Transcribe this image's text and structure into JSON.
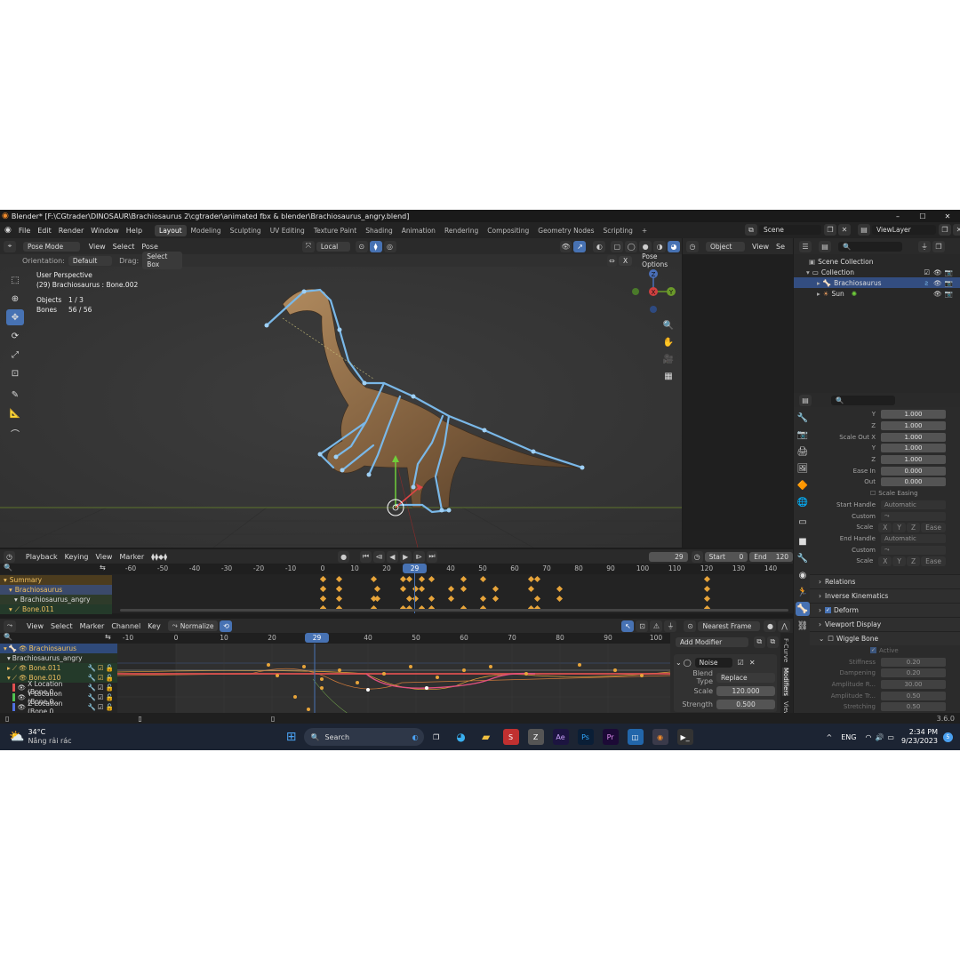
{
  "title_bar": {
    "title": "Blender* [F:\\CGtrader\\DINOSAUR\\Brachiosaurus 2\\cgtrader\\animated fbx & blender\\Brachiosaurus_angry.blend]",
    "minimize": "–",
    "maximize": "☐",
    "close": "✕"
  },
  "menu": {
    "items": [
      "File",
      "Edit",
      "Render",
      "Window",
      "Help"
    ],
    "workspaces": [
      "Layout",
      "Modeling",
      "Sculpting",
      "UV Editing",
      "Texture Paint",
      "Shading",
      "Animation",
      "Rendering",
      "Compositing",
      "Geometry Nodes",
      "Scripting"
    ],
    "active_workspace": "Layout",
    "add_tab": "+",
    "scene_label": "Scene",
    "view_layer_label": "ViewLayer"
  },
  "viewport": {
    "mode": "Pose Mode",
    "header_menus": [
      "View",
      "Select",
      "Pose"
    ],
    "transform_orientation": "Local",
    "orientation_label": "Orientation:",
    "orientation_value": "Default",
    "drag_label": "Drag:",
    "drag_value": "Select Box",
    "pose_options": "Pose Options",
    "x_mirror": "X",
    "overlay_title": "User Perspective",
    "overlay_subtitle": "(29) Brachiosaurus : Bone.002",
    "stats": [
      {
        "label": "Objects",
        "value": "1 / 3"
      },
      {
        "label": "Bones",
        "value": "56 / 56"
      }
    ],
    "gizmo": {
      "x": "X",
      "y": "Y",
      "z": "Z"
    }
  },
  "camera_view": {
    "type": "Object",
    "menus": [
      "View",
      "Se"
    ]
  },
  "outliner": {
    "search_placeholder": "",
    "root": "Scene Collection",
    "collection": "Collection",
    "objects": [
      {
        "name": "Brachiosaurus",
        "selected": true
      },
      {
        "name": "Sun",
        "selected": false
      }
    ]
  },
  "properties": {
    "rows": [
      {
        "label": "Y",
        "value": "1.000"
      },
      {
        "label": "Z",
        "value": "1.000"
      },
      {
        "label": "Scale Out X",
        "value": "1.000"
      },
      {
        "label": "Y",
        "value": "1.000"
      },
      {
        "label": "Z",
        "value": "1.000"
      },
      {
        "label": "Ease In",
        "value": "0.000"
      },
      {
        "label": "Out",
        "value": "0.000"
      }
    ],
    "scale_easing": "Scale Easing",
    "start_handle_label": "Start Handle",
    "start_handle_value": "Automatic",
    "custom_label": "Custom",
    "scale_label": "Scale",
    "axes": [
      "X",
      "Y",
      "Z"
    ],
    "ease": "Ease",
    "end_handle_label": "End Handle",
    "end_handle_value": "Automatic",
    "panels": [
      "Relations",
      "Inverse Kinematics",
      "Deform",
      "Viewport Display",
      "Wiggle Bone"
    ],
    "wiggle": {
      "active": "Active",
      "rows": [
        {
          "label": "Stiffness",
          "value": "0.20"
        },
        {
          "label": "Dampening",
          "value": "0.20"
        },
        {
          "label": "Amplitude R...",
          "value": "30.00"
        },
        {
          "label": "Amplitude Tr...",
          "value": "0.50"
        },
        {
          "label": "Stretching",
          "value": "0.50"
        }
      ]
    }
  },
  "timeline": {
    "menus": [
      "Playback",
      "Keying",
      "View",
      "Marker"
    ],
    "current_frame": "29",
    "start_label": "Start",
    "start_value": "0",
    "end_label": "End",
    "end_value": "120",
    "ruler": [
      "-60",
      "-50",
      "-40",
      "-30",
      "-20",
      "-10",
      "0",
      "10",
      "20",
      "30",
      "40",
      "50",
      "60",
      "70",
      "80",
      "90",
      "100",
      "110",
      "120",
      "130",
      "140"
    ],
    "channels": [
      "Summary",
      "Brachiosaurus",
      "Brachiosaurus_angry",
      "Bone.011"
    ]
  },
  "graph_editor": {
    "menus": [
      "View",
      "Select",
      "Marker",
      "Channel",
      "Key"
    ],
    "normalize": "Normalize",
    "snap": "Nearest Frame",
    "ruler": [
      "-10",
      "0",
      "10",
      "20",
      "30",
      "40",
      "50",
      "60",
      "70",
      "80",
      "90",
      "100"
    ],
    "channels": [
      {
        "name": "Brachiosaurus",
        "style": "object"
      },
      {
        "name": "Brachiosaurus_angry",
        "style": "action"
      },
      {
        "name": "Bone.011",
        "style": "group"
      },
      {
        "name": "Bone.010",
        "style": "group"
      },
      {
        "name": "X Location (Bone.0...",
        "style": "curve",
        "color": "#e05050"
      },
      {
        "name": "Y Location (Bone.0...",
        "style": "curve",
        "color": "#50c050"
      },
      {
        "name": "Z Location (Bone.0...",
        "style": "curve",
        "color": "#5070e0"
      }
    ],
    "modifier": {
      "add": "Add Modifier",
      "name": "Noise",
      "blend_type_label": "Blend Type",
      "blend_type_value": "Replace",
      "scale_label": "Scale",
      "scale_value": "120.000",
      "strength_label": "Strength",
      "strength_value": "0.500"
    },
    "side_tabs": [
      "F-Curve",
      "Modifiers",
      "View"
    ]
  },
  "status_bar": {
    "version": "3.6.0"
  },
  "taskbar": {
    "weather_temp": "34°C",
    "weather_desc": "Nắng rải rác",
    "search_label": "Search",
    "language": "ENG",
    "time": "2:34 PM",
    "date": "9/23/2023",
    "notification_count": "5",
    "apps": [
      "Ae",
      "Ps",
      "Pr"
    ]
  },
  "colors": {
    "accent": "#4772b3",
    "keyframe": "#e7a43a",
    "bone": "#7ab8e8"
  }
}
